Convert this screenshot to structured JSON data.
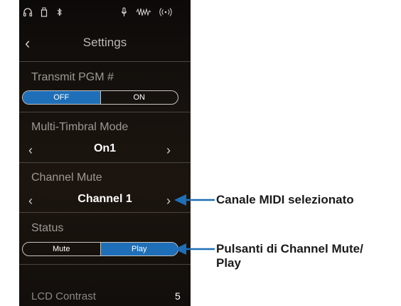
{
  "status_bar": {
    "icons": [
      "headphones-icon",
      "usb-icon",
      "bluetooth-icon",
      "mic-icon",
      "waveform-icon",
      "wireless-icon"
    ]
  },
  "nav": {
    "back_glyph": "‹",
    "title": "Settings"
  },
  "settings": {
    "transmit_pgm": {
      "label": "Transmit PGM #",
      "off_label": "OFF",
      "on_label": "ON",
      "selected": "OFF"
    },
    "multi_timbral": {
      "label": "Multi-Timbral Mode",
      "value": "On1"
    },
    "channel_mute": {
      "label": "Channel Mute",
      "value": "Channel 1"
    },
    "status": {
      "label": "Status",
      "mute_label": "Mute",
      "play_label": "Play",
      "selected": "Play"
    },
    "lcd_contrast": {
      "label": "LCD Contrast",
      "value": "5"
    }
  },
  "arrows": {
    "left": "‹",
    "right": "›"
  },
  "callouts": {
    "channel_selected": "Canale MIDI selezionato",
    "mute_play_line1": "Pulsanti di Channel Mute/",
    "mute_play_line2": "Play",
    "color": "#1f6fb8"
  }
}
